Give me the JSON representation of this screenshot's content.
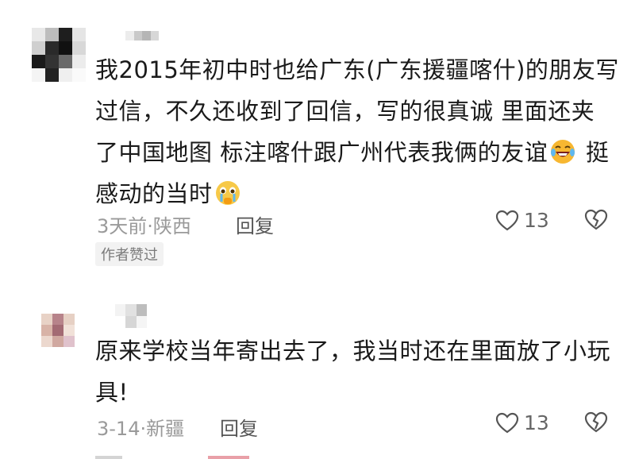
{
  "comments": [
    {
      "lines": [
        "我2015年初中时也给广东(广东援疆喀什)的朋友写",
        "过信，不久还收到了回信，写的很真诚 里面还夹",
        "了中国地图 标注喀什跟广州代表我俩的友谊",
        "感动的当时"
      ],
      "line3_tail": "挺",
      "emoji_a": "laughing-tears-emoji",
      "emoji_b": "crying-emoji",
      "date": "3天前",
      "dot": "·",
      "location": "陕西",
      "reply_label": "回复",
      "likes": "13",
      "badge": "作者赞过"
    },
    {
      "lines": [
        "原来学校当年寄出去了，我当时还在里面放了小玩",
        "具!"
      ],
      "date": "3-14",
      "dot": "·",
      "location": "新疆",
      "reply_label": "回复",
      "likes": "13"
    }
  ],
  "colors": {
    "text": "#1a1a1a",
    "meta": "#9a9a9a",
    "like_icon": "#555555",
    "badge_bg": "#f2f2f2"
  },
  "icons": {
    "like": "heart-outline-icon",
    "dislike": "broken-heart-icon"
  }
}
